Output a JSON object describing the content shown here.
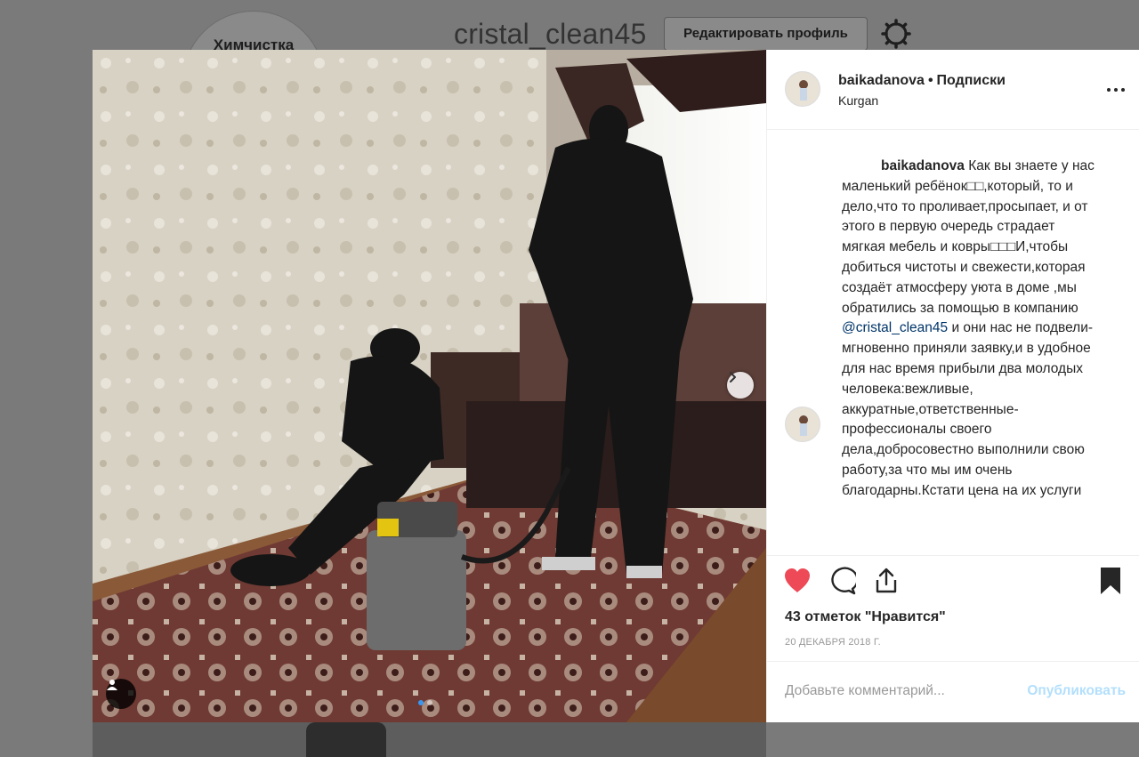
{
  "background": {
    "avatar_text": "Химчистка",
    "username": "cristal_clean45",
    "edit_profile_label": "Редактировать профиль",
    "settings_icon": "gear-icon"
  },
  "post": {
    "username": "baikadanova",
    "follow_label": "Подписки",
    "location": "Kurgan",
    "caption_user": "baikadanova",
    "caption_before_mention": "Как вы знаете у нас маленький ребёнок□□,который, то и дело,что то проливает,просыпает, и от этого в первую очередь страдает мягкая мебель и ковры□□□И,чтобы добиться чистоты и свежести,которая создаёт атмосферу уюта в доме ,мы обратились за помощью в компанию",
    "mention": "@cristal_clean45",
    "caption_after_mention": "и они нас не подвели-мгновенно приняли заявку,и в удобное для нас время прибыли два молодых человека:вежливые, аккуратные,ответственные-профессионалы своего дела,добросовестно выполнили свою работу,за что мы им очень благодарны.Кстати цена на их услуги",
    "likes_text": "43 отметок \"Нравится\"",
    "date": "20 ДЕКАБРЯ 2018 Г.",
    "comment_placeholder": "Добавьте комментарий...",
    "publish_label": "Опубликовать",
    "liked": true,
    "accent_color": "#ed4956",
    "link_color": "#003569",
    "carousel": {
      "current": 1,
      "total": 2
    }
  }
}
